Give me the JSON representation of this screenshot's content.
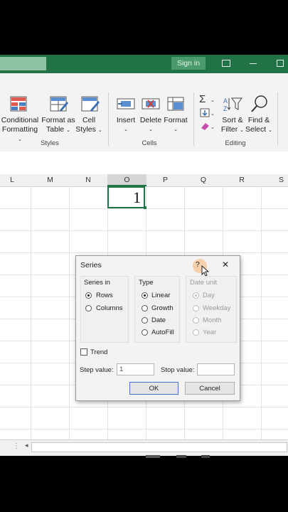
{
  "titlebar": {
    "signin_label": "Sign in"
  },
  "ribbon": {
    "styles": {
      "group": "Styles",
      "conditional_line1": "Conditional",
      "conditional_line2": "Formatting",
      "format_table_line1": "Format as",
      "format_table_line2": "Table",
      "cell_styles_line1": "Cell",
      "cell_styles_line2": "Styles"
    },
    "cells": {
      "group": "Cells",
      "insert": "Insert",
      "delete": "Delete",
      "format": "Format"
    },
    "editing": {
      "group": "Editing",
      "sigma": "Σ",
      "sort_line1": "Sort &",
      "sort_line2": "Filter",
      "find_line1": "Find &",
      "find_line2": "Select"
    },
    "chevron": "⌄"
  },
  "sheet": {
    "columns": [
      "L",
      "M",
      "N",
      "O",
      "P",
      "Q",
      "R",
      "S"
    ],
    "selected_cell_value": "1"
  },
  "dialog": {
    "title": "Series",
    "help": "?",
    "close": "✕",
    "series_in": {
      "label": "Series in",
      "options": [
        "Rows",
        "Columns"
      ],
      "selected": "Rows"
    },
    "type": {
      "label": "Type",
      "options": [
        "Linear",
        "Growth",
        "Date",
        "AutoFill"
      ],
      "selected": "Linear"
    },
    "date_unit": {
      "label": "Date unit",
      "options": [
        "Day",
        "Weekday",
        "Month",
        "Year"
      ],
      "selected": "Day"
    },
    "trend_label": "Trend",
    "step_label": "Step value:",
    "step_value": "1",
    "stop_label": "Stop value:",
    "stop_value": "",
    "ok": "OK",
    "cancel": "Cancel"
  }
}
